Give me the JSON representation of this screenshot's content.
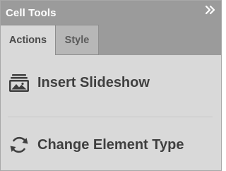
{
  "panel": {
    "title": "Cell Tools",
    "collapse_icon": "double-chevron-right-icon"
  },
  "tabs": [
    {
      "label": "Actions",
      "active": true
    },
    {
      "label": "Style",
      "active": false
    }
  ],
  "actions": [
    {
      "label": "Insert Slideshow",
      "icon": "slideshow-icon"
    },
    {
      "label": "Change Element Type",
      "icon": "refresh-cycle-icon"
    }
  ],
  "colors": {
    "title_bar": "#9b9b9b",
    "panel_bg": "#d9d9d9",
    "inactive_tab": "#b7b7b7",
    "text": "#3f3f3f"
  }
}
